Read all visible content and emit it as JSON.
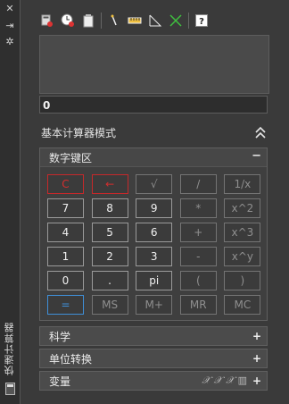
{
  "palette": {
    "title": "快速计算器",
    "icons": [
      "close-icon",
      "collapse-strip-icon",
      "settings-icon",
      "calculator-icon"
    ]
  },
  "toolbar": {
    "icons": [
      "clear-icon",
      "history-icon",
      "paste-to-command-icon",
      "distance-icon",
      "angle-icon",
      "intersection-icon",
      "help-icon"
    ]
  },
  "input": {
    "value": "0"
  },
  "mode": {
    "title": "基本计算器模式"
  },
  "keypad": {
    "title": "数字键区",
    "toggle": "−",
    "keys": [
      [
        "C",
        "←",
        "√",
        "/",
        "1/x"
      ],
      [
        "7",
        "8",
        "9",
        "*",
        "x^2"
      ],
      [
        "4",
        "5",
        "6",
        "+",
        "x^3"
      ],
      [
        "1",
        "2",
        "3",
        "-",
        "x^y"
      ],
      [
        "0",
        ".",
        "pi",
        "(",
        ")"
      ],
      [
        "=",
        "MS",
        "M+",
        "MR",
        "MC"
      ]
    ]
  },
  "sections": {
    "science": {
      "title": "科学",
      "toggle": "+"
    },
    "units": {
      "title": "单位转换",
      "toggle": "+"
    },
    "variables": {
      "title": "变量",
      "toggle": "+"
    }
  },
  "colors": {
    "accent_red": "#d42e2e",
    "accent_blue": "#3f8fd8",
    "bg": "#3a3a3a"
  }
}
